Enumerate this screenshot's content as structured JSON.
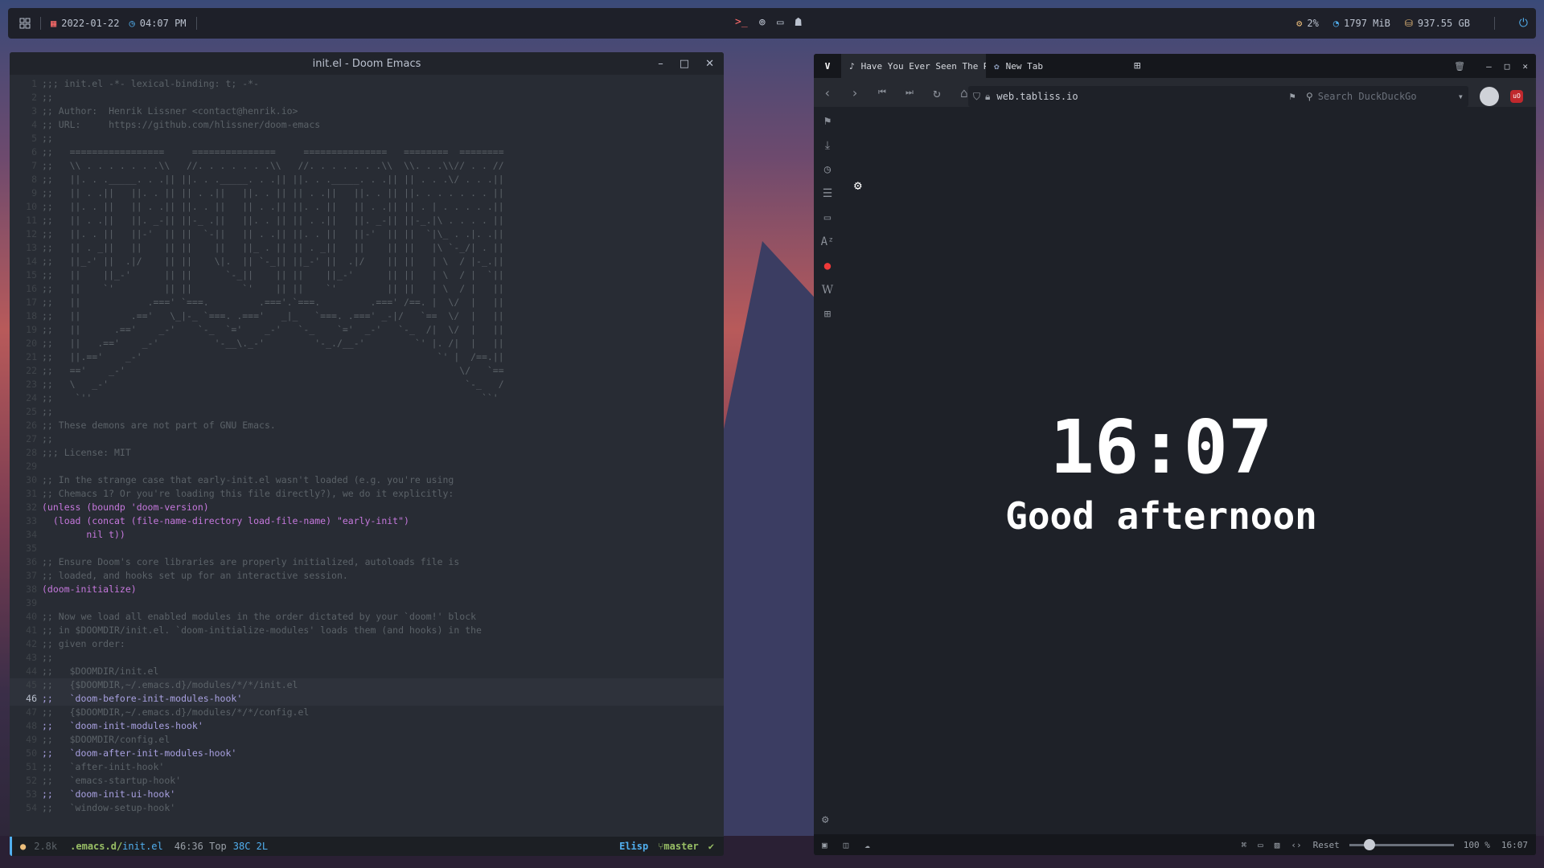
{
  "topbar": {
    "date": "2022-01-22",
    "time": "04:07 PM",
    "cpu": "2%",
    "mem": "1797 MiB",
    "disk": "937.55 GB"
  },
  "emacs": {
    "title": "init.el - Doom Emacs",
    "lines": [
      ";;; init.el -*- lexical-binding: t; -*-",
      ";;",
      ";; Author:  Henrik Lissner <contact@henrik.io>",
      ";; URL:     https://github.com/hlissner/doom-emacs",
      ";;",
      ";;   =================     ===============     ===============   ========  ========",
      ";;   \\\\ . . . . . . .\\\\   //. . . . . . .\\\\   //. . . . . . .\\\\  \\\\. . .\\\\// . . //",
      ";;   ||. . ._____. . .|| ||. . ._____. . .|| ||. . ._____. . .|| || . . .\\/ . . .||",
      ";;   || . .||   ||. . || || . .||   ||. . || || . .||   ||. . || ||. . . . . . . ||",
      ";;   ||. . ||   || . .|| ||. . ||   || . .|| ||. . ||   || . .|| || . | . . . . .||",
      ";;   || . .||   ||. _-|| ||-_ .||   ||. . || || . .||   ||. _-|| ||-_.|\\ . . . . ||",
      ";;   ||. . ||   ||-'  || ||  `-||   || . .|| ||. . ||   ||-'  || ||  `|\\_ . .|. .||",
      ";;   || . _||   ||    || ||    ||   ||_ . || || . _||   ||    || ||   |\\ `-_/| . ||",
      ";;   ||_-' ||  .|/    || ||    \\|.  || `-_|| ||_-' ||  .|/    || ||   | \\  / |-_.||",
      ";;   ||    ||_-'      || ||      `-_||    || ||    ||_-'      || ||   | \\  / |  `||",
      ";;   ||    `'         || ||         `'    || ||    `'         || ||   | \\  / |   ||",
      ";;   ||            .===' `===.         .==='.`===.         .===' /==. |  \\/  |   ||",
      ";;   ||         .=='   \\_|-_ `===. .==='   _|_   `===. .===' _-|/   `==  \\/  |   ||",
      ";;   ||      .=='    _-'    `-_  `='    _-'   `-_    `='  _-'   `-_  /|  \\/  |   ||",
      ";;   ||   .=='    _-'          '-__\\._-'         '-_./__-'         `' |. /|  |   ||",
      ";;   ||.=='    _-'                                                     `' |  /==.||",
      ";;   =='    _-'                                                            \\/   `==",
      ";;   \\   _-'                                                                `-_   /",
      ";;    `''                                                                      ``'",
      ";;",
      ";; These demons are not part of GNU Emacs.",
      ";;",
      ";;; License: MIT",
      "",
      ";; In the strange case that early-init.el wasn't loaded (e.g. you're using",
      ";; Chemacs 1? Or you're loading this file directly?), we do it explicitly:",
      "(unless (boundp 'doom-version)",
      "  (load (concat (file-name-directory load-file-name) \"early-init\")",
      "        nil t))",
      "",
      ";; Ensure Doom's core libraries are properly initialized, autoloads file is",
      ";; loaded, and hooks set up for an interactive session.",
      "(doom-initialize)",
      "",
      ";; Now we load all enabled modules in the order dictated by your `doom!' block",
      ";; in $DOOMDIR/init.el. `doom-initialize-modules' loads them (and hooks) in the",
      ";; given order:",
      ";;",
      ";;   $DOOMDIR/init.el",
      ";;   {$DOOMDIR,~/.emacs.d}/modules/*/*/init.el",
      ";;   `doom-before-init-modules-hook'",
      ";;   {$DOOMDIR,~/.emacs.d}/modules/*/*/config.el",
      ";;   `doom-init-modules-hook'",
      ";;   $DOOMDIR/config.el",
      ";;   `doom-after-init-modules-hook'",
      ";;   `after-init-hook'",
      ";;   `emacs-startup-hook'",
      ";;   `doom-init-ui-hook'",
      ";;   `window-setup-hook'"
    ],
    "modeline": {
      "size": "2.8k",
      "dir": ".emacs.d/",
      "file": "init.el",
      "pos": "46:36 Top",
      "lsp": "38C 2L",
      "mode": "Elisp",
      "branch": "master"
    }
  },
  "browser": {
    "tabs": [
      {
        "label": "Have You Ever Seen The R"
      },
      {
        "label": "New Tab"
      }
    ],
    "url": "web.tabliss.io",
    "search_placeholder": "Search DuckDuckGo",
    "clock": "16:07",
    "greeting": "Good afternoon",
    "status": {
      "reset": "Reset",
      "zoom": "100 %",
      "time": "16:07"
    }
  }
}
